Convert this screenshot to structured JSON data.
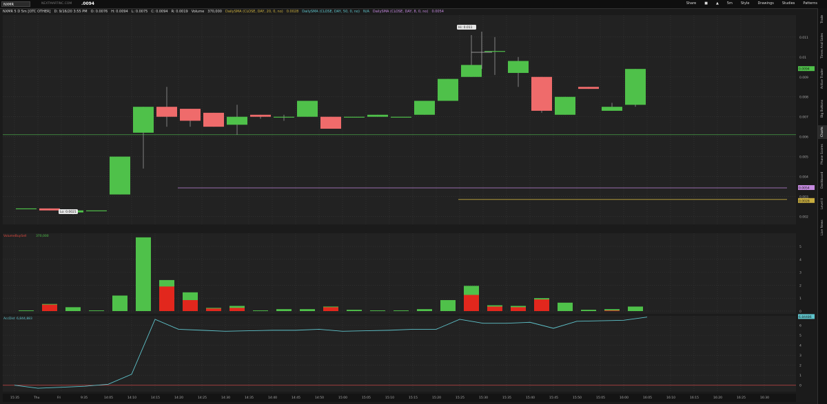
{
  "header": {
    "symbol": "NXMR",
    "ticker_site": "NEXTMARTINC.COM",
    "last_price": ".0094",
    "info": [
      "NXMR 5 D 5m [OTC OTHER]",
      "D: 9/16/20 3:55 PM",
      "O: 0.0076",
      "H: 0.0094",
      "L: 0.0075",
      "C: 0.0094",
      "R: 0.0019",
      "Volume",
      "370,000"
    ],
    "studies": [
      "DailySMA (CLOSE, DAY, 20, 0, no)",
      "0.0028",
      "DailySMA (CLOSE, DAY, 50, 0, no)",
      "N/A",
      "DailySMA (CLOSE, DAY, 8, 0, no)",
      "0.0054"
    ],
    "tools": [
      "Share",
      "5m",
      "Style",
      "Drawings",
      "Studies",
      "Patterns"
    ]
  },
  "sidebar": {
    "items": [
      "Trade",
      "Times And Sales",
      "Active Trader",
      "Big Buttons",
      "Charts",
      "Phase Scores",
      "Dashboard",
      "Level II",
      "Live News"
    ],
    "active": "Charts"
  },
  "colors": {
    "up": "#4fc14a",
    "down": "#ef6b6b",
    "sell": "#e2271d",
    "grid": "#3a3a3a",
    "panel_bg": "#222222",
    "sma8": "#c58ae0",
    "sma20": "#c9ae3f",
    "hline": "#4aa24a",
    "ad_line": "#5fc4cc",
    "zero_line": "#c94a4a"
  },
  "chart_data": [
    {
      "type": "candlestick",
      "ylim": [
        0.0016,
        0.0121
      ],
      "y_ticks": [
        "0.011",
        "0.01",
        "0.009",
        "0.008",
        "0.007",
        "0.006",
        "0.005",
        "0.004",
        "0.003",
        "0.002"
      ],
      "x_labels": [
        "15:35",
        "Thu",
        "Fri",
        "9:35",
        "14:05",
        "14:10",
        "14:15",
        "14:20",
        "14:25",
        "14:30",
        "14:35",
        "14:40",
        "14:45",
        "14:50",
        "15:00",
        "15:05",
        "15:10",
        "15:15",
        "15:20",
        "15:25",
        "15:30",
        "15:35",
        "15:40",
        "15:45",
        "15:50",
        "15:05",
        "16:00",
        "16:05",
        "16:10",
        "16:15",
        "16:20",
        "16:25",
        "16:30"
      ],
      "candles": [
        {
          "o": 0.0024,
          "h": 0.0024,
          "l": 0.0024,
          "c": 0.0024
        },
        {
          "o": 0.0024,
          "h": 0.0024,
          "l": 0.0023,
          "c": 0.0023
        },
        {
          "o": 0.0022,
          "h": 0.0023,
          "l": 0.0021,
          "c": 0.0023
        },
        {
          "o": 0.0023,
          "h": 0.0023,
          "l": 0.0023,
          "c": 0.0023
        },
        {
          "o": 0.0031,
          "h": 0.005,
          "l": 0.0031,
          "c": 0.005
        },
        {
          "o": 0.0062,
          "h": 0.0075,
          "l": 0.0044,
          "c": 0.0075
        },
        {
          "o": 0.0075,
          "h": 0.0085,
          "l": 0.0065,
          "c": 0.007
        },
        {
          "o": 0.0074,
          "h": 0.0074,
          "l": 0.0065,
          "c": 0.0068
        },
        {
          "o": 0.0072,
          "h": 0.0072,
          "l": 0.0065,
          "c": 0.0065
        },
        {
          "o": 0.0066,
          "h": 0.0076,
          "l": 0.0061,
          "c": 0.007
        },
        {
          "o": 0.0071,
          "h": 0.0071,
          "l": 0.0069,
          "c": 0.007
        },
        {
          "o": 0.007,
          "h": 0.0071,
          "l": 0.0068,
          "c": 0.007
        },
        {
          "o": 0.007,
          "h": 0.0078,
          "l": 0.007,
          "c": 0.0078
        },
        {
          "o": 0.007,
          "h": 0.007,
          "l": 0.0064,
          "c": 0.0064
        },
        {
          "o": 0.007,
          "h": 0.007,
          "l": 0.007,
          "c": 0.007
        },
        {
          "o": 0.007,
          "h": 0.0071,
          "l": 0.007,
          "c": 0.0071
        },
        {
          "o": 0.007,
          "h": 0.007,
          "l": 0.007,
          "c": 0.007
        },
        {
          "o": 0.0071,
          "h": 0.0078,
          "l": 0.0071,
          "c": 0.0078
        },
        {
          "o": 0.0078,
          "h": 0.0089,
          "l": 0.0078,
          "c": 0.0089
        },
        {
          "o": 0.009,
          "h": 0.0111,
          "l": 0.009,
          "c": 0.0096
        },
        {
          "o": 0.0103,
          "h": 0.011,
          "l": 0.0091,
          "c": 0.0103
        },
        {
          "o": 0.0092,
          "h": 0.01,
          "l": 0.0085,
          "c": 0.0098
        },
        {
          "o": 0.009,
          "h": 0.009,
          "l": 0.0072,
          "c": 0.0073
        },
        {
          "o": 0.0071,
          "h": 0.008,
          "l": 0.0071,
          "c": 0.008
        },
        {
          "o": 0.0085,
          "h": 0.0085,
          "l": 0.0084,
          "c": 0.0084
        },
        {
          "o": 0.0073,
          "h": 0.0077,
          "l": 0.0073,
          "c": 0.0075
        },
        {
          "o": 0.0076,
          "h": 0.0094,
          "l": 0.0075,
          "c": 0.0094
        }
      ],
      "hi_label": "Hi: 0.011",
      "lo_label": "Lo: 0.0021",
      "price_badge": "0.0094",
      "sma8_badge": "0.0054",
      "sma20_badge": "0.0028",
      "hline_value": 0.0061,
      "sma8_value": 0.00343,
      "sma20_value": 0.00285
    },
    {
      "type": "bar",
      "title": "VolumeBuySell",
      "value_label": "370,000",
      "y_ticks": [
        "5",
        "4",
        "3",
        "2",
        "1",
        "0"
      ],
      "ylim": [
        0,
        5.8
      ],
      "buy": [
        0.05,
        0.05,
        0.3,
        0.05,
        1.2,
        5.7,
        0.5,
        0.6,
        0.05,
        0.15,
        0.05,
        0.15,
        0.15,
        0.05,
        0.1,
        0.05,
        0.05,
        0.15,
        0.85,
        0.7,
        0.1,
        0.1,
        0.1,
        0.65,
        0.1,
        0.1,
        0.35
      ],
      "sell": [
        0.0,
        0.5,
        0.0,
        0.0,
        0.0,
        0.0,
        1.9,
        0.85,
        0.2,
        0.25,
        0.0,
        0.0,
        0.0,
        0.3,
        0.0,
        0.0,
        0.0,
        0.0,
        0.0,
        1.25,
        0.35,
        0.3,
        0.9,
        0.0,
        0.0,
        0.05,
        0.0
      ]
    },
    {
      "type": "line",
      "title": "AccDist",
      "value_label": "6,844,883",
      "badge": "6.84486",
      "y_ticks": [
        "6",
        "5",
        "4",
        "3",
        "2",
        "1",
        "0"
      ],
      "ylim": [
        -0.5,
        6.8
      ],
      "values": [
        0.0,
        -0.3,
        -0.2,
        -0.1,
        0.1,
        1.1,
        6.6,
        5.6,
        5.5,
        5.4,
        5.45,
        5.5,
        5.5,
        5.6,
        5.4,
        5.45,
        5.5,
        5.6,
        5.6,
        6.6,
        6.2,
        6.2,
        6.3,
        5.7,
        6.4,
        6.45,
        6.5,
        6.82
      ]
    }
  ]
}
